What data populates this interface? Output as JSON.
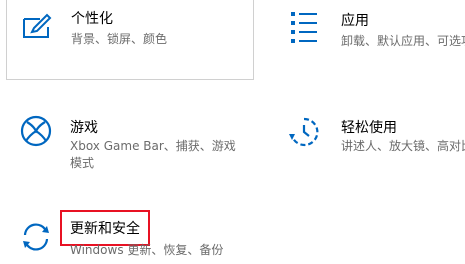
{
  "settings": {
    "accent_color": "#0067c0",
    "highlight_color": "#e81123",
    "tiles": [
      {
        "id": "personalization",
        "icon": "personalization-icon",
        "title": "个性化",
        "description": "背景、锁屏、颜色"
      },
      {
        "id": "apps",
        "icon": "apps-list-icon",
        "title": "应用",
        "description": "卸载、默认应用、可选功能"
      },
      {
        "id": "gaming",
        "icon": "xbox-icon",
        "title": "游戏",
        "description_line1": "Xbox Game Bar、捕获、游戏",
        "description_line2": "模式"
      },
      {
        "id": "ease-of-access",
        "icon": "ease-of-access-icon",
        "title": "轻松使用",
        "description": "讲述人、放大镜、高对比度"
      },
      {
        "id": "update-security",
        "icon": "sync-arrows-icon",
        "title": "更新和安全",
        "description": "Windows 更新、恢复、备份"
      }
    ]
  }
}
